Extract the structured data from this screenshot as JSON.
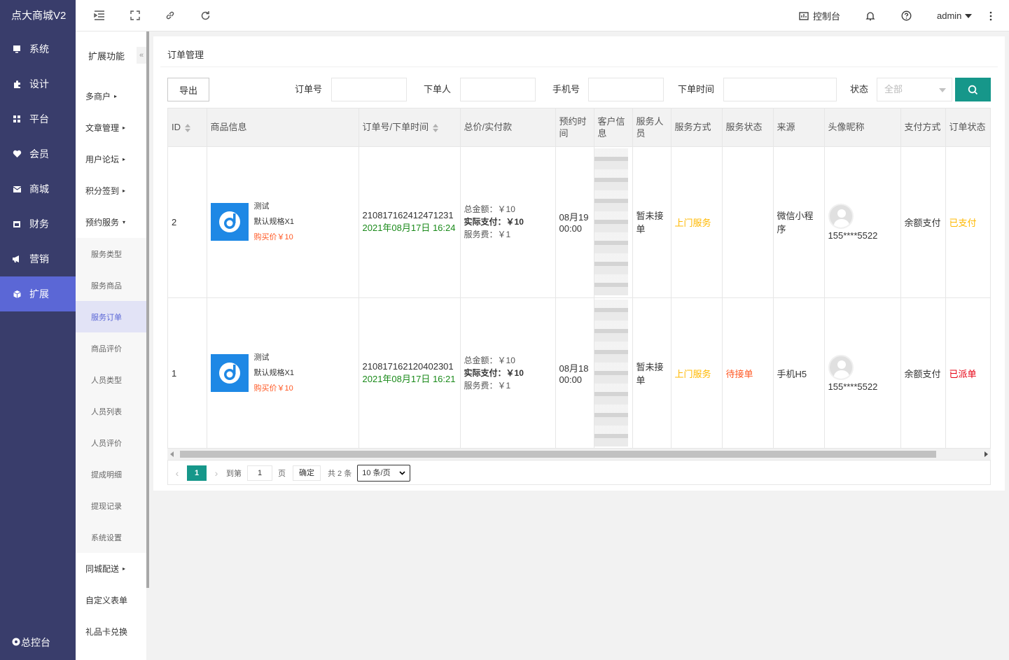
{
  "brand": "点大商城V2",
  "main_nav": [
    {
      "label": "系统",
      "icon": "monitor-icon"
    },
    {
      "label": "设计",
      "icon": "puzzle-icon"
    },
    {
      "label": "平台",
      "icon": "grid-icon"
    },
    {
      "label": "会员",
      "icon": "heart-icon"
    },
    {
      "label": "商城",
      "icon": "mail-icon"
    },
    {
      "label": "财务",
      "icon": "calendar-icon"
    },
    {
      "label": "营销",
      "icon": "megaphone-icon"
    },
    {
      "label": "扩展",
      "icon": "cube-icon",
      "active": true
    }
  ],
  "bottom_nav": {
    "label": "总控台",
    "icon": "gear-icon"
  },
  "topbar": {
    "console_label": "控制台",
    "user": "admin"
  },
  "subnav": {
    "title": "扩展功能",
    "collapse_glyph": "«",
    "items": [
      {
        "label": "多商户",
        "arrow": "▸"
      },
      {
        "label": "文章管理",
        "arrow": "▸"
      },
      {
        "label": "用户论坛",
        "arrow": "▸"
      },
      {
        "label": "积分签到",
        "arrow": "▸"
      },
      {
        "label": "预约服务",
        "arrow": "▾"
      }
    ],
    "children": [
      {
        "label": "服务类型"
      },
      {
        "label": "服务商品"
      },
      {
        "label": "服务订单",
        "active": true
      },
      {
        "label": "商品评价"
      },
      {
        "label": "人员类型"
      },
      {
        "label": "人员列表"
      },
      {
        "label": "人员评价"
      },
      {
        "label": "提成明细"
      },
      {
        "label": "提现记录"
      },
      {
        "label": "系统设置"
      }
    ],
    "after": [
      {
        "label": "同城配送",
        "arrow": "▸"
      },
      {
        "label": "自定义表单",
        "arrow": ""
      },
      {
        "label": "礼品卡兑换",
        "arrow": ""
      }
    ]
  },
  "page_title": "订单管理",
  "filters": {
    "export_label": "导出",
    "order_no_label": "订单号",
    "buyer_label": "下单人",
    "phone_label": "手机号",
    "time_label": "下单时间",
    "status_label": "状态",
    "status_value": "全部"
  },
  "columns": [
    "ID",
    "商品信息",
    "订单号/下单时间",
    "总价/实付款",
    "预约时间",
    "客户信息",
    "服务人员",
    "服务方式",
    "服务状态",
    "来源",
    "头像昵称",
    "支付方式",
    "订单状态"
  ],
  "rows": [
    {
      "id": "2",
      "goods_name": "测试",
      "goods_spec": "默认规格X1",
      "goods_price": "购买价￥10",
      "order_no": "210817162412471231",
      "order_time": "2021年08月17日 16:24",
      "total_label": "总金额：",
      "total": "￥10",
      "paid_label": "实际支付：",
      "paid": "￥10",
      "fee_label": "服务费：",
      "fee": "￥1",
      "appt_date": "08月19",
      "appt_time": "00:00",
      "staff": "暂未接单",
      "service_mode": "上门服务",
      "service_status": "",
      "source": "微信小程序",
      "nickname": "155****5522",
      "pay_method": "余额支付",
      "order_status": "已支付"
    },
    {
      "id": "1",
      "goods_name": "测试",
      "goods_spec": "默认规格X1",
      "goods_price": "购买价￥10",
      "order_no": "210817162120402301",
      "order_time": "2021年08月17日 16:21",
      "total_label": "总金额：",
      "total": "￥10",
      "paid_label": "实际支付：",
      "paid": "￥10",
      "fee_label": "服务费：",
      "fee": "￥1",
      "appt_date": "08月18",
      "appt_time": "00:00",
      "staff": "暂未接单",
      "service_mode": "上门服务",
      "service_status": "待接单",
      "source": "手机H5",
      "nickname": "155****5522",
      "pay_method": "余额支付",
      "order_status": "已派单"
    }
  ],
  "pager": {
    "current": "1",
    "goto_label": "到第",
    "goto_value": "1",
    "page_unit": "页",
    "confirm_label": "确定",
    "total_label": "共 2 条",
    "page_size": "10 条/页"
  },
  "colors": {
    "sidebar": "#393d6b",
    "active": "#5b67d6",
    "primary": "#16978a"
  }
}
